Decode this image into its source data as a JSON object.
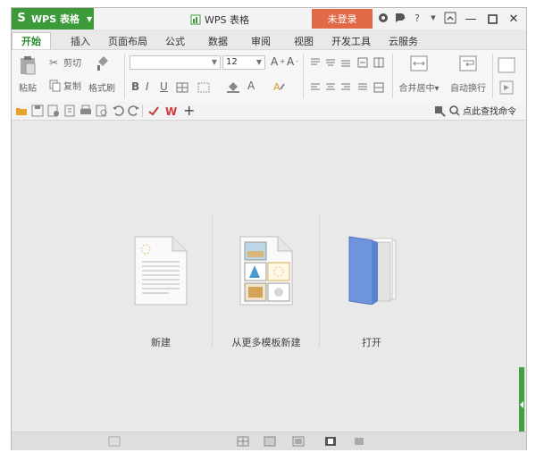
{
  "titlebar": {
    "app_logo": "S",
    "app_name": "WPS 表格",
    "document_title": "WPS 表格",
    "login_label": "未登录",
    "help_label": "?",
    "icons": [
      "skin-icon",
      "feedback-icon",
      "help-icon",
      "collapse-ribbon-icon"
    ]
  },
  "tabs": [
    {
      "label": "开始",
      "active": true
    },
    {
      "label": "插入"
    },
    {
      "label": "页面布局"
    },
    {
      "label": "公式"
    },
    {
      "label": "数据"
    },
    {
      "label": "审阅"
    },
    {
      "label": "视图"
    },
    {
      "label": "开发工具"
    },
    {
      "label": "云服务"
    }
  ],
  "ribbon": {
    "paste_label": "粘贴",
    "cut_label": "剪切",
    "copy_label": "复制",
    "format_painter_label": "格式刷",
    "font_name": "",
    "font_size": "12",
    "merge_center_label": "合并居中",
    "wrap_text_label": "自动换行"
  },
  "quickbar": {
    "search_label": "点此查找命令"
  },
  "main": {
    "new_label": "新建",
    "new_from_template_label": "从更多模板新建",
    "open_label": "打开"
  },
  "colors": {
    "accent": "#3d9a3b",
    "login": "#e06a48",
    "tab_active_text": "#2b8a2b"
  }
}
